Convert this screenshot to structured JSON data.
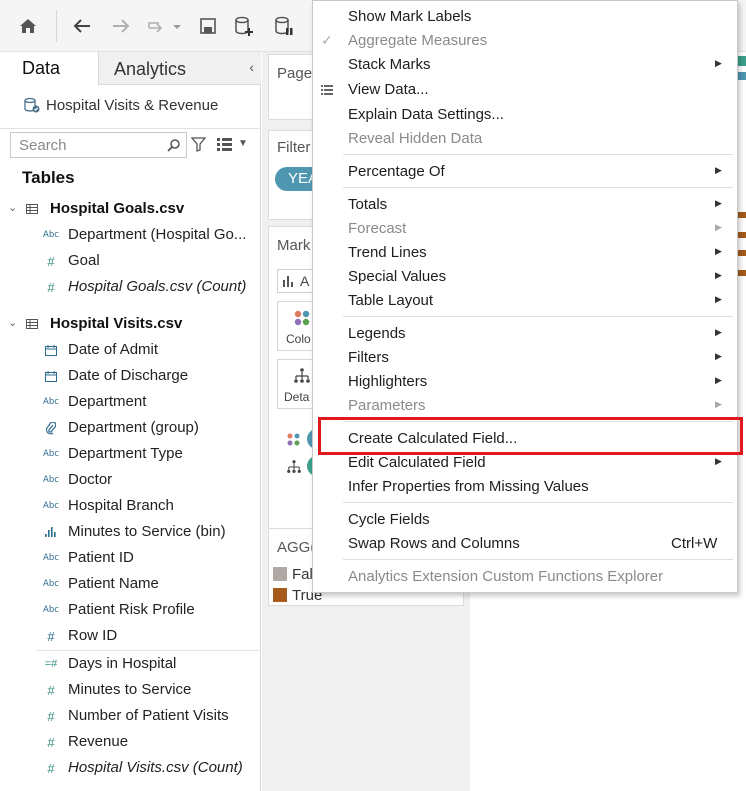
{
  "toolbar": {
    "icons": [
      "home-icon",
      "back-arrow-icon",
      "forward-arrow-icon",
      "redo-icon",
      "save-icon",
      "new-datasource-icon",
      "datasource-pause-icon"
    ]
  },
  "left_pane": {
    "tabs": {
      "data": "Data",
      "analytics": "Analytics"
    },
    "datasource_name": "Hospital Visits & Revenue",
    "search_placeholder": "Search",
    "tables_heading": "Tables",
    "tables": [
      {
        "name": "Hospital Goals.csv",
        "fields": [
          {
            "icon": "Abc",
            "name": "Department (Hospital Go...",
            "italic": false
          },
          {
            "icon": "#",
            "name": "Goal",
            "italic": false
          },
          {
            "icon": "#",
            "name": "Hospital Goals.csv (Count)",
            "italic": true
          }
        ]
      },
      {
        "name": "Hospital Visits.csv",
        "dimensions": [
          {
            "icon": "calendar",
            "name": "Date of Admit"
          },
          {
            "icon": "calendar",
            "name": "Date of Discharge"
          },
          {
            "icon": "Abc",
            "name": "Department"
          },
          {
            "icon": "paperclip",
            "name": "Department (group)"
          },
          {
            "icon": "Abc",
            "name": "Department Type"
          },
          {
            "icon": "Abc",
            "name": "Doctor"
          },
          {
            "icon": "Abc",
            "name": "Hospital Branch"
          },
          {
            "icon": "bin",
            "name": "Minutes to Service (bin)"
          },
          {
            "icon": "Abc",
            "name": "Patient ID"
          },
          {
            "icon": "Abc",
            "name": "Patient Name"
          },
          {
            "icon": "Abc",
            "name": "Patient Risk Profile"
          },
          {
            "icon": "#",
            "name": "Row ID"
          }
        ],
        "measures": [
          {
            "icon": "=#",
            "name": "Days in Hospital",
            "italic": false
          },
          {
            "icon": "#",
            "name": "Minutes to Service",
            "italic": false
          },
          {
            "icon": "#",
            "name": "Number of Patient Visits",
            "italic": false
          },
          {
            "icon": "#",
            "name": "Revenue",
            "italic": false
          },
          {
            "icon": "#",
            "name": "Hospital Visits.csv (Count)",
            "italic": true
          }
        ]
      }
    ]
  },
  "shelves": {
    "pages_title": "Page",
    "filters_title": "Filter",
    "filter_pill": "YEA",
    "marks_title": "Mark",
    "marks_type_text": "A",
    "color_label": "Colo",
    "detail_label": "Deta",
    "legend_title": "AGG(",
    "legend_items": [
      {
        "label": "Fal",
        "color": "#b0a8a4"
      },
      {
        "label": "True",
        "color": "#a65a1c"
      }
    ]
  },
  "context_menu": {
    "items": [
      {
        "label": "Show Mark Labels",
        "disabled": false,
        "submenu": false
      },
      {
        "label": "Aggregate Measures",
        "disabled": true,
        "checked": true,
        "submenu": false
      },
      {
        "label": "Stack Marks",
        "disabled": false,
        "submenu": true
      },
      {
        "label": "View Data...",
        "disabled": false,
        "submenu": false,
        "icon": "view-data-icon"
      },
      {
        "label": "Explain Data Settings...",
        "disabled": false,
        "submenu": false
      },
      {
        "label": "Reveal Hidden Data",
        "disabled": true,
        "submenu": false
      },
      {
        "label": "Percentage Of",
        "disabled": false,
        "submenu": true
      },
      {
        "label": "Totals",
        "disabled": false,
        "submenu": true
      },
      {
        "label": "Forecast",
        "disabled": true,
        "submenu": true
      },
      {
        "label": "Trend Lines",
        "disabled": false,
        "submenu": true
      },
      {
        "label": "Special Values",
        "disabled": false,
        "submenu": true
      },
      {
        "label": "Table Layout",
        "disabled": false,
        "submenu": true
      },
      {
        "label": "Legends",
        "disabled": false,
        "submenu": true
      },
      {
        "label": "Filters",
        "disabled": false,
        "submenu": true
      },
      {
        "label": "Highlighters",
        "disabled": false,
        "submenu": true
      },
      {
        "label": "Parameters",
        "disabled": true,
        "submenu": true
      },
      {
        "label": "Create Calculated Field...",
        "disabled": false,
        "submenu": false,
        "highlighted": true
      },
      {
        "label": "Edit Calculated Field",
        "disabled": false,
        "submenu": true
      },
      {
        "label": "Infer Properties from Missing Values",
        "disabled": false,
        "submenu": false
      },
      {
        "label": "Cycle Fields",
        "disabled": false,
        "submenu": false
      },
      {
        "label": "Swap Rows and Columns",
        "disabled": false,
        "submenu": false,
        "shortcut": "Ctrl+W"
      },
      {
        "label": "Analytics Extension Custom Functions Explorer",
        "disabled": true,
        "submenu": false
      }
    ]
  },
  "colors": {
    "highlight_box": "#e0191c",
    "filter_pill": "#4f97b0",
    "field_green": "#3a8f80",
    "field_blue": "#2b6c8e"
  }
}
